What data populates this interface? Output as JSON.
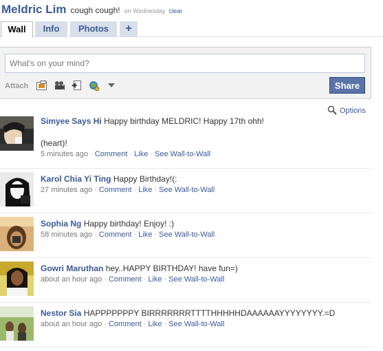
{
  "profile": {
    "name": "Meldric Lim",
    "status": "cough cough!",
    "status_time": "on Wednesday",
    "clear_label": "clear"
  },
  "tabs": [
    {
      "label": "Wall",
      "active": true
    },
    {
      "label": "Info",
      "active": false
    },
    {
      "label": "Photos",
      "active": false
    },
    {
      "label": "+",
      "active": false
    }
  ],
  "publisher": {
    "placeholder": "What's on your mind?",
    "attach_label": "Attach",
    "share_label": "Share",
    "attach_icons": [
      "photo-icon",
      "video-icon",
      "link-icon",
      "gift-icon",
      "dropdown-arrow-icon"
    ]
  },
  "options_label": "Options",
  "actions": {
    "comment": "Comment",
    "like": "Like",
    "wall": "See Wall-to-Wall"
  },
  "posts": [
    {
      "author": "Simyee Says Hi",
      "message": "Happy birthday MELDRIC! Happy 17th ohh!",
      "message_cont": "(heart)!",
      "time": "5 minutes ago"
    },
    {
      "author": "Karol Chia Yi Ting",
      "message": "Happy Birthday!(:",
      "time": "27 minutes ago"
    },
    {
      "author": "Sophia Ng",
      "message": "Happy birthday! Enjoy! :)",
      "time": "58 minutes ago"
    },
    {
      "author": "Gowri Maruthan",
      "message": "hey..HAPPY BIRTHDAY! have fun=)",
      "time": "about an hour ago"
    },
    {
      "author": "Nestor Sia",
      "message": "HAPPPPPPPY BIRRRRRRRTTTTHHHHHDAAAAAAYYYYYYYY.=D",
      "time": "about an hour ago"
    }
  ],
  "colors": {
    "link": "#3b5998",
    "tab_bg": "#d8dfea",
    "share_bg": "#5b74a8",
    "publisher_bg": "#f2f2f2"
  }
}
